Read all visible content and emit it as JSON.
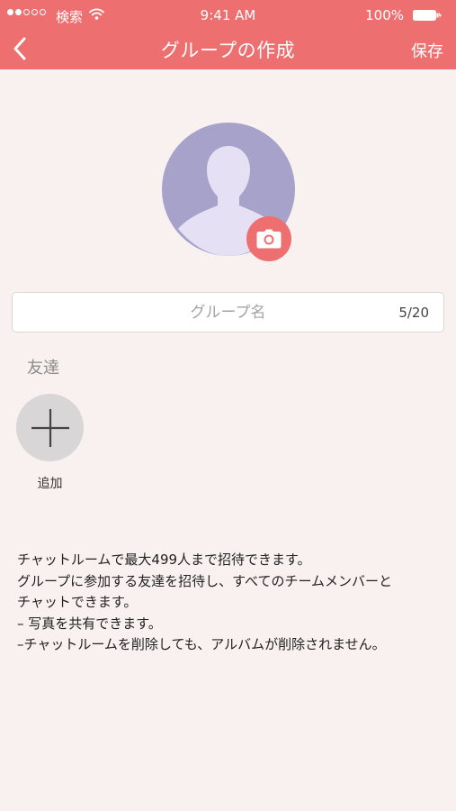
{
  "status_bar": {
    "carrier": "検索",
    "time": "9:41 AM",
    "battery": "100%"
  },
  "header": {
    "back_icon": "chevron-left-icon",
    "title": "グループの作成",
    "save_label": "保存"
  },
  "avatar": {
    "icon": "person-silhouette-icon",
    "camera_icon": "camera-icon"
  },
  "group_name": {
    "placeholder": "グループ名",
    "value": "",
    "counter": "5/20"
  },
  "friends": {
    "label": "友達",
    "add_icon": "plus-icon",
    "add_label": "追加"
  },
  "notes": [
    "チャットルームで最大499人まで招待できます。",
    "グループに参加する友達を招待し、すべてのチームメンバーと",
    "チャットできます。",
    "– 写真を共有できます。",
    "–チャットルームを削除しても、アルバムが削除されません。"
  ],
  "colors": {
    "accent": "#ee6f70",
    "background": "#f8f1f0",
    "avatar_bg": "#a6a2c9",
    "avatar_figure": "#e5e0f3",
    "add_button": "#d8d6d7"
  }
}
